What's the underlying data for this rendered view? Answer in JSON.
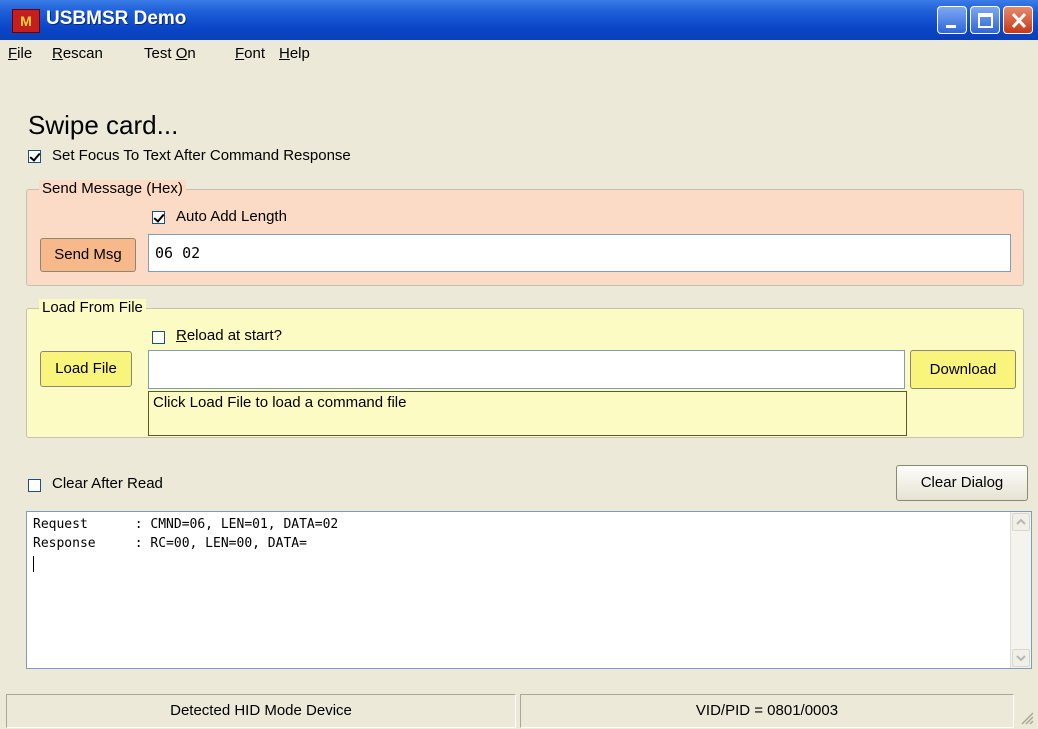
{
  "window": {
    "title": "USBMSR Demo",
    "icon": "app-logo-icon"
  },
  "menu": [
    {
      "pre": "",
      "ul": "F",
      "post": "ile"
    },
    {
      "pre": "",
      "ul": "R",
      "post": "escan"
    },
    {
      "pre": "Test ",
      "ul": "O",
      "post": "n"
    },
    {
      "pre": "",
      "ul": "F",
      "post": "ont"
    },
    {
      "pre": "",
      "ul": "H",
      "post": "elp"
    }
  ],
  "status_prompt": "Swipe card...",
  "focus_option": {
    "label": "Set Focus To Text After Command Response",
    "checked": true
  },
  "send_group": {
    "title": "Send Message (Hex)",
    "auto_add_length": {
      "label": "Auto Add Length",
      "checked": true
    },
    "send_button": "Send Msg",
    "message_value": "06 02"
  },
  "load_group": {
    "title": "Load From File",
    "reload_option": {
      "pre": "",
      "ul": "R",
      "post": "eload at start?",
      "checked": false
    },
    "load_button": "Load File",
    "file_path_value": "",
    "download_button": "Download",
    "info_text": "Click Load File to load a command file"
  },
  "clear_after_read": {
    "label": "Clear After Read",
    "checked": false
  },
  "clear_dialog_button": "Clear Dialog",
  "log": [
    "Request      : CMND=06, LEN=01, DATA=02",
    "Response     : RC=00, LEN=00, DATA="
  ],
  "statusbar": {
    "left": "Detected HID Mode Device",
    "right": "VID/PID = 0801/0003"
  },
  "colors": {
    "title_bar": "#0a46c8",
    "send_group_bg": "#fbdbc5",
    "load_group_bg": "#fdfbc4"
  }
}
